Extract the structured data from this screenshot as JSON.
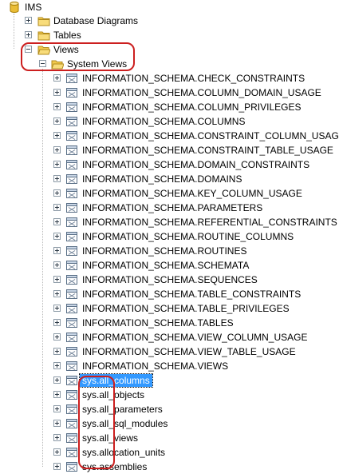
{
  "database": {
    "label": "IMS"
  },
  "nodes": {
    "database_diagrams": "Database Diagrams",
    "tables": "Tables",
    "views": "Views",
    "system_views": "System Views"
  },
  "system_views": [
    "INFORMATION_SCHEMA.CHECK_CONSTRAINTS",
    "INFORMATION_SCHEMA.COLUMN_DOMAIN_USAGE",
    "INFORMATION_SCHEMA.COLUMN_PRIVILEGES",
    "INFORMATION_SCHEMA.COLUMNS",
    "INFORMATION_SCHEMA.CONSTRAINT_COLUMN_USAGE",
    "INFORMATION_SCHEMA.CONSTRAINT_TABLE_USAGE",
    "INFORMATION_SCHEMA.DOMAIN_CONSTRAINTS",
    "INFORMATION_SCHEMA.DOMAINS",
    "INFORMATION_SCHEMA.KEY_COLUMN_USAGE",
    "INFORMATION_SCHEMA.PARAMETERS",
    "INFORMATION_SCHEMA.REFERENTIAL_CONSTRAINTS",
    "INFORMATION_SCHEMA.ROUTINE_COLUMNS",
    "INFORMATION_SCHEMA.ROUTINES",
    "INFORMATION_SCHEMA.SCHEMATA",
    "INFORMATION_SCHEMA.SEQUENCES",
    "INFORMATION_SCHEMA.TABLE_CONSTRAINTS",
    "INFORMATION_SCHEMA.TABLE_PRIVILEGES",
    "INFORMATION_SCHEMA.TABLES",
    "INFORMATION_SCHEMA.VIEW_COLUMN_USAGE",
    "INFORMATION_SCHEMA.VIEW_TABLE_USAGE",
    "INFORMATION_SCHEMA.VIEWS",
    "sys.all_columns",
    "sys.all_objects",
    "sys.all_parameters",
    "sys.all_sql_modules",
    "sys.all_views",
    "sys.allocation_units",
    "sys.assemblies"
  ],
  "selected_view": "sys.all_columns",
  "icons": {
    "database": "database-cylinder-icon",
    "folder": "folder-icon",
    "view": "view-icon",
    "expand": "expand-plus-icon",
    "collapse": "collapse-minus-icon"
  },
  "colors": {
    "selection": "#3399ff",
    "annotation": "#cc1f1f",
    "folder": "#f2c94c"
  }
}
